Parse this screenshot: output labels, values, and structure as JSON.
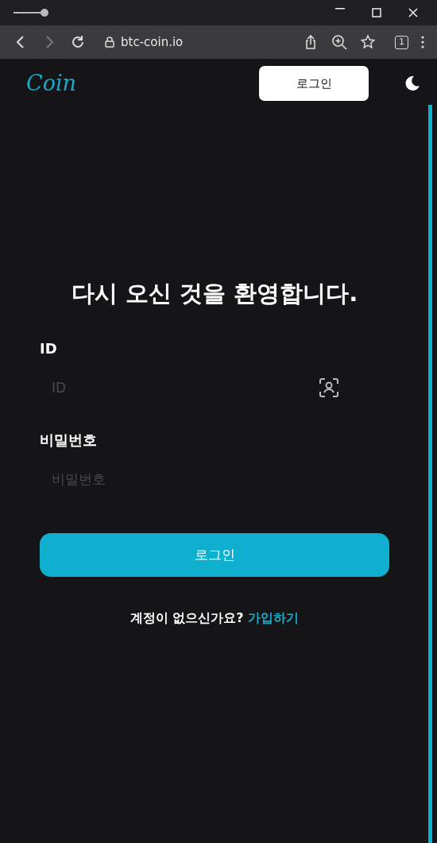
{
  "browser": {
    "url": "btc-coin.io",
    "tab_count": "1"
  },
  "header": {
    "logo": "Coin",
    "login_button": "로그인"
  },
  "heading": "다시 오신 것을 환영합니다.",
  "fields": [
    {
      "label": "ID",
      "placeholder": "ID",
      "kind": "id"
    },
    {
      "label": "비밀번호",
      "placeholder": "비밀번호",
      "kind": "password"
    }
  ],
  "submit_button": "로그인",
  "signup": {
    "prompt": "계정이 없으신가요?",
    "link": "가입하기"
  }
}
